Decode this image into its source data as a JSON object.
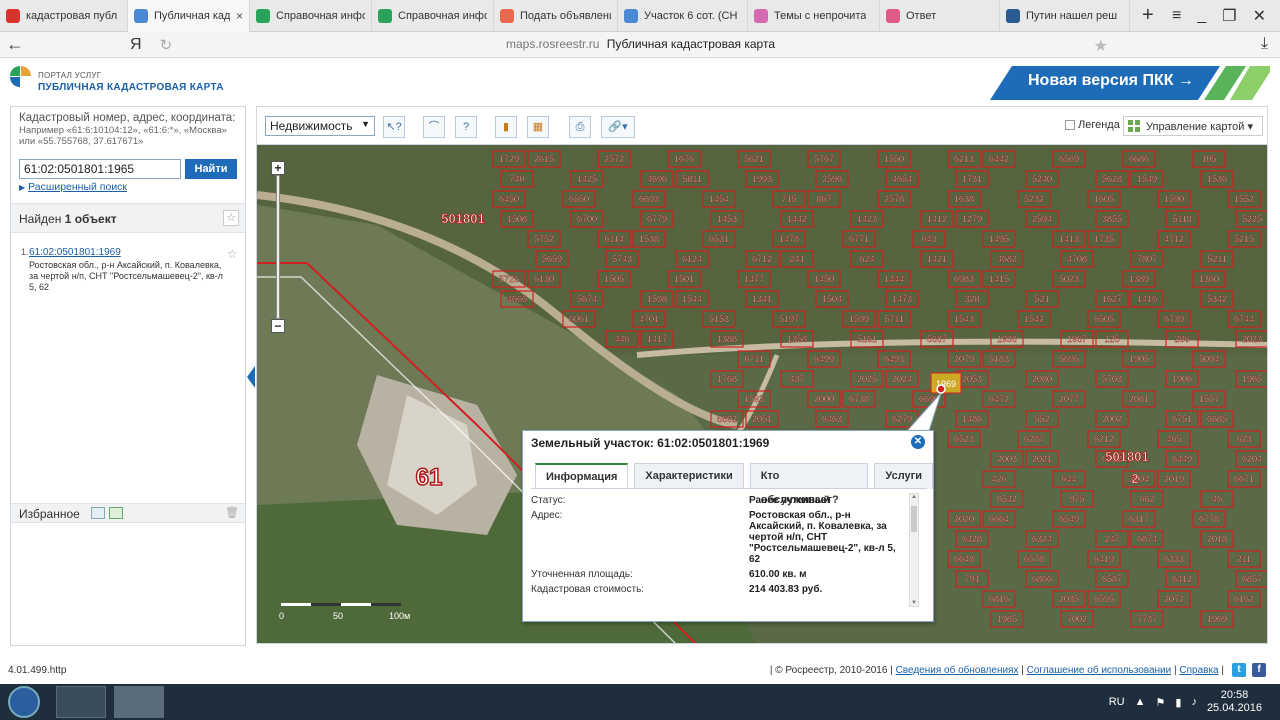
{
  "browser": {
    "tabs": [
      {
        "icon": "yandex-icon",
        "label": "кадастровая публ",
        "color": "#d9342b",
        "active": false
      },
      {
        "icon": "pkk-icon",
        "label": "Публичная кад",
        "color": "#4a8ad4",
        "active": true
      },
      {
        "icon": "rosreestr-icon",
        "label": "Справочная инфо",
        "color": "#2aa35a",
        "active": false
      },
      {
        "icon": "rosreestr-icon",
        "label": "Справочная инфо",
        "color": "#2aa35a",
        "active": false
      },
      {
        "icon": "avito-icon",
        "label": "Подать объявлени",
        "color": "#e8694d",
        "active": false
      },
      {
        "icon": "avito-icon",
        "label": "Участок 6 сот. (СН",
        "color": "#4a8ad4",
        "active": false
      },
      {
        "icon": "forum-icon",
        "label": "Темы с непрочита",
        "color": "#d46ab0",
        "active": false
      },
      {
        "icon": "flower-icon",
        "label": "Ответ",
        "color": "#e05a8a",
        "active": false
      },
      {
        "icon": "rt-icon",
        "label": "Путин нашел реш",
        "color": "#2a5b94",
        "active": false
      }
    ],
    "address": {
      "domain": "maps.rosreestr.ru",
      "page_title": "Публичная кадастровая карта",
      "yandex_letter": "Я"
    }
  },
  "site": {
    "brand_top": "ПОРТАЛ УСЛУГ",
    "brand_bottom": "ПУБЛИЧНАЯ КАДАСТРОВАЯ КАРТА",
    "new_version_label": "Новая версия ПКК →",
    "accent_color": "#1e6bb8",
    "green_color": "#2f8a3b"
  },
  "search": {
    "label": "Кадастровый номер, адрес, координата:",
    "hint": "Например «61:6:10104:12», «61:6:*», «Москва» или «55.755768, 37.617671»",
    "value": "61:02:0501801:1965",
    "button_label": "Найти",
    "advanced_label": "Расширенный поиск"
  },
  "results": {
    "found_prefix": "Найден",
    "found_count": "1 объект",
    "items": [
      {
        "num": "1.",
        "cadastral": "61:02:0501801:1969",
        "address": "Ростовская обл., р-н Аксайский, п. Ковалевка, за чертой н/п, СНТ \"Ростсельмашевец-2\", кв-л 5, 62"
      }
    ]
  },
  "favorites": {
    "label": "Избранное"
  },
  "toolbar": {
    "layer_select": "Недвижимость",
    "legend_label": "Легенда",
    "map_control_label": "Управление картой"
  },
  "map": {
    "block_labels": [
      "501801",
      "61",
      "501801",
      "2"
    ],
    "scale_labels": [
      "0",
      "50",
      "100м"
    ],
    "parcel_numbers": [
      "1729",
      "2615",
      "2572",
      "1676",
      "5621",
      "5767",
      "1550",
      "6213",
      "6442",
      "6569",
      "6686",
      "105",
      "740",
      "1425",
      "4696",
      "5811",
      "1993",
      "2596",
      "4654",
      "1731",
      "5240",
      "5628",
      "1549",
      "1536",
      "6450",
      "6550",
      "6693",
      "1454",
      "715",
      "867",
      "2578",
      "1638",
      "5232",
      "1605",
      "1590",
      "1552",
      "1508",
      "6700",
      "6779",
      "1453",
      "1442",
      "1423",
      "1412",
      "1279",
      "2594",
      "3855",
      "5118",
      "5225",
      "5752",
      "6114",
      "1538",
      "6531",
      "1478",
      "6771",
      "643",
      "1495",
      "1413",
      "1735",
      "4712",
      "5215",
      "5659",
      "5743",
      "6124",
      "6712",
      "241",
      "624",
      "1421",
      "4682",
      "4708",
      "7807",
      "5211",
      "5726",
      "6130",
      "1505",
      "1501",
      "1477",
      "1450",
      "1444",
      "6983",
      "1415",
      "5023",
      "1389",
      "1360",
      "4666",
      "5674",
      "1598",
      "1544",
      "1341",
      "1504",
      "1473",
      "328",
      "521",
      "1627",
      "1416",
      "5342",
      "6061",
      "4701",
      "5153",
      "5197",
      "1599",
      "5711",
      "1543",
      "1542",
      "6505",
      "6739",
      "6744",
      "446",
      "1417",
      "1388",
      "1358",
      "5161",
      "5687",
      "1938",
      "1967",
      "125",
      "286",
      "2023",
      "6711",
      "6499",
      "6493",
      "2079",
      "5183",
      "5695",
      "1905",
      "5094",
      "1768",
      "437",
      "2025",
      "2024",
      "2053",
      "2080",
      "5703",
      "1906",
      "1965",
      "1593",
      "2000",
      "6738",
      "6699",
      "6472",
      "2077",
      "2081",
      "1557",
      "6692",
      "2051",
      "6463",
      "6279",
      "1486",
      "552",
      "2002",
      "6751",
      "6685",
      "6523",
      "6287",
      "6212",
      "465",
      "623",
      "2003",
      "2021",
      "6532",
      "6449",
      "6204",
      "426",
      "644",
      "2004",
      "2019",
      "6671",
      "6542",
      "975",
      "662",
      "46",
      "2020",
      "6664",
      "6549",
      "6317",
      "6778",
      "6428",
      "6324",
      "247",
      "6874",
      "2018",
      "6648",
      "6578",
      "6419",
      "6333",
      "211",
      "791",
      "6866",
      "6587",
      "6412",
      "6857",
      "6816",
      "2035",
      "6595",
      "2072",
      "6162",
      "1985",
      "7002",
      "7737",
      "1969"
    ],
    "selected_parcel": "1969"
  },
  "popup": {
    "title": "Земельный участок: 61:02:0501801:1969",
    "tabs": [
      "Информация",
      "Характеристики",
      "Кто обслуживает?",
      "Услуги"
    ],
    "active_tab": "Информация",
    "rows": [
      {
        "key": "Статус:",
        "value": "Ранее учтенный"
      },
      {
        "key": "Адрес:",
        "value": "Ростовская обл., р-н Аксайский, п. Ковалевка, за чертой н/п, СНТ \"Ростсельмашевец-2\", кв-л 5, 62"
      },
      {
        "key": "Уточненная площадь:",
        "value": "610.00 кв. м"
      },
      {
        "key": "Кадастровая стоимость:",
        "value": "214 403.83 руб."
      }
    ]
  },
  "status": {
    "version": "4.01.499.http",
    "copyright": "| © Росреестр, 2010-2016 |",
    "links": [
      "Сведения об обновлениях",
      "Соглашение об использовании",
      "Справка"
    ]
  },
  "taskbar": {
    "lang": "RU",
    "time": "20:58",
    "date": "25.04.2016"
  }
}
